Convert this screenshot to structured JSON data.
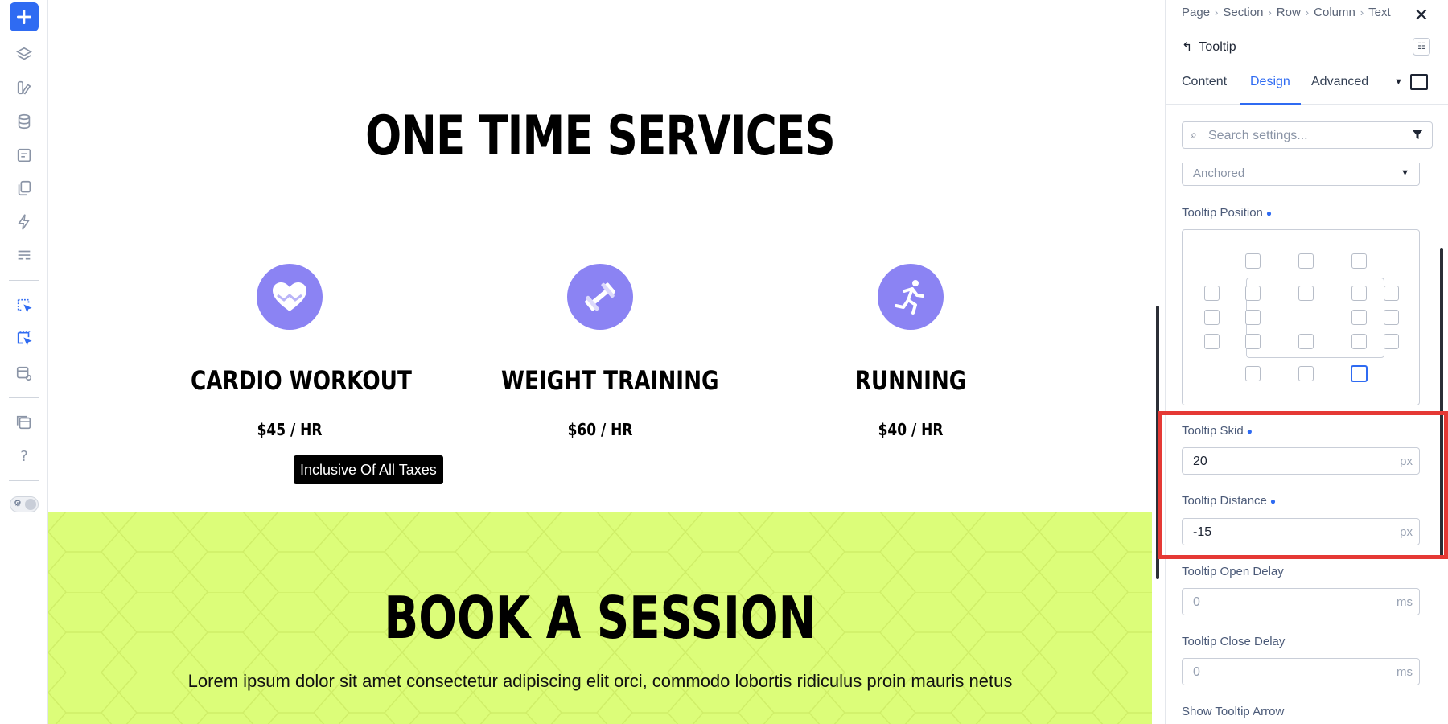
{
  "toolbar": {
    "items": [
      "add",
      "layers",
      "design-library",
      "database",
      "forms",
      "pages",
      "dynamic",
      "templates",
      "select-element",
      "select-multiple",
      "preview",
      "panels",
      "help",
      "theme-toggle"
    ]
  },
  "canvas": {
    "title": "ONE TIME SERVICES",
    "services": [
      {
        "name": "CARDIO WORKOUT",
        "price": "$45 / HR",
        "icon": "heart-icon"
      },
      {
        "name": "WEIGHT TRAINING",
        "price": "$60 / HR",
        "icon": "dumbbell-icon"
      },
      {
        "name": "RUNNING",
        "price": "$40 / HR",
        "icon": "runner-icon"
      }
    ],
    "tooltip": "Inclusive Of All Taxes",
    "book_title": "BOOK A SESSION",
    "book_text": "Lorem ipsum dolor sit amet consectetur adipiscing elit orci, commodo lobortis ridiculus proin mauris netus"
  },
  "panel": {
    "breadcrumb": [
      "Page",
      "Section",
      "Row",
      "Column",
      "Text"
    ],
    "back_label": "Tooltip",
    "tabs": [
      "Content",
      "Design",
      "Advanced"
    ],
    "active_tab": "Design",
    "search_placeholder": "Search settings...",
    "anchored_value": "Anchored",
    "position_label": "Tooltip Position",
    "skid_label": "Tooltip Skid",
    "skid_value": "20",
    "skid_unit": "px",
    "distance_label": "Tooltip Distance",
    "distance_value": "-15",
    "distance_unit": "px",
    "open_delay_label": "Tooltip Open Delay",
    "open_delay_value": "0",
    "open_delay_unit": "ms",
    "close_delay_label": "Tooltip Close Delay",
    "close_delay_value": "0",
    "close_delay_unit": "ms",
    "arrow_label": "Show Tooltip Arrow"
  },
  "colors": {
    "accent": "#2f6bf2",
    "service_icon": "#8b83f3",
    "book_bg": "#dcfd79",
    "highlight": "#e53935"
  }
}
